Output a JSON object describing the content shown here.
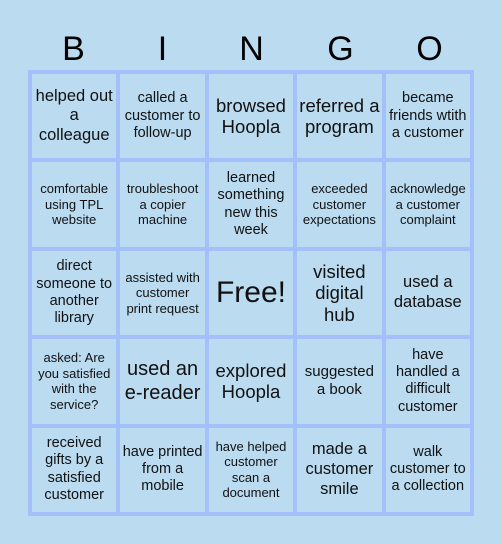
{
  "header": [
    "B",
    "I",
    "N",
    "G",
    "O"
  ],
  "cells": [
    "helped out a colleague",
    "called a customer to follow-up",
    "browsed Hoopla",
    "referred a program",
    "became friends wtith a customer",
    "comfortable using TPL website",
    "troubleshoot a copier machine",
    "learned something new this week",
    "exceeded customer expectations",
    "acknowledge a customer complaint",
    "direct someone to another library",
    "assisted with customer print request",
    "Free!",
    "visited digital hub",
    "used a database",
    "asked: Are you satisfied with the service?",
    "used an e-reader",
    "explored Hoopla",
    "suggested a book",
    "have handled a difficult customer",
    "received gifts by a satisfied customer",
    "have printed from a mobile",
    "have helped customer scan a document",
    "made a customer smile",
    "walk customer to a collection"
  ],
  "colors": {
    "background": "#bbdbf1",
    "grid_border": "#a3c0fb"
  }
}
